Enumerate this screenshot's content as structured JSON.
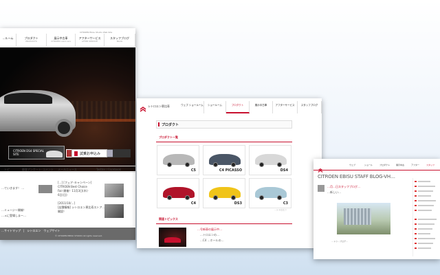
{
  "card1": {
    "site_title": "CITROEN Ebisu Studio Web Site",
    "nav": [
      {
        "label": "…ルーム",
        "sub": ""
      },
      {
        "label": "プロダクト",
        "sub": "PRODUCTS"
      },
      {
        "label": "展示中古車",
        "sub": "CITROEN used cars"
      },
      {
        "label": "アフターサービス",
        "sub": "AFTER SERVICE"
      },
      {
        "label": "スタッフブログ",
        "sub": "BLOG"
      }
    ],
    "ds_banner_text": "CITROEN DS4 SPECIAL SITE",
    "test_drive_label": "試乗お申込み",
    "bottom_nav": [
      "…トピ",
      "顧客アンケート･コメント",
      "メールニュース",
      "Twitter / Facebook"
    ],
    "news_items": [
      "[…] [フェア･キャンペーン]",
      "CITROEN Best Choice",
      "Fair 開催！11月3日(木)･",
      "6日(日)",
      "[2011/10/…]",
      "[店舗情報] シトロエン恵比寿ストア…",
      "開設！"
    ],
    "left_news": [
      "…ていきます！ …",
      "…ミュージー開催！",
      "…ュに登場しまー…"
    ],
    "footer_links": "…サイトマップ　|　シトロエン　ウェブサイト",
    "footer_copy": "© CITROEN EBISU STUDIO All rights reserved."
  },
  "card2": {
    "brand_name": "シトロエン恵比寿",
    "nav": [
      "ウェブ ショールーム",
      "ショールーム",
      "プロダクト",
      "展示中古車",
      "アフターサービス",
      "スタッフブログ"
    ],
    "page_heading": "プロダクト",
    "section_product_list": "プロダクト一覧",
    "products": [
      {
        "name": "C5",
        "color": "#b8b8b8"
      },
      {
        "name": "C4 PICASSO",
        "color": "#4a5666"
      },
      {
        "name": "DS4",
        "color": "#d8d8d8"
      },
      {
        "name": "C4",
        "color": "#b0142a"
      },
      {
        "name": "DS3",
        "color": "#f0c419"
      },
      {
        "name": "C3",
        "color": "#a9c8d6"
      }
    ],
    "more_link": "…シトロエン",
    "section_topics": "関連トピックス",
    "topic_lines": [
      "…号新車の展示中…",
      "…トロエンの…",
      "…C4 …ホールの…"
    ]
  },
  "card3": {
    "nav": [
      "ウェブ",
      "ショール",
      "プロダクト",
      "展示中古",
      "アフター",
      "スタッフ"
    ],
    "blog_title": "CITROEN EBISU STAFF BLOG-VH…",
    "post_lines": [
      "…月…日スタッフブログ…",
      "…新しい…"
    ],
    "caption": "…トゥ…ブログ…"
  },
  "colors": {
    "accent_red": "#c8102e"
  }
}
